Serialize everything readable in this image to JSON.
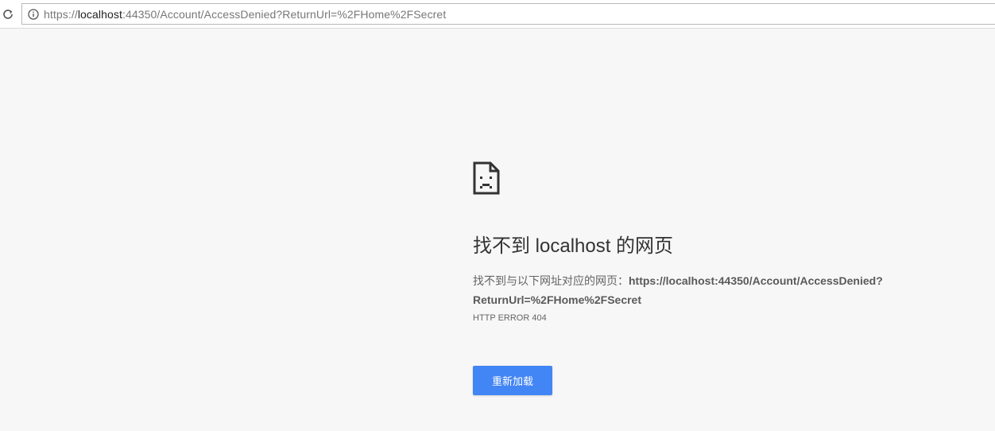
{
  "browser": {
    "url_scheme": "https://",
    "url_host": "localhost",
    "url_rest": ":44350/Account/AccessDenied?ReturnUrl=%2FHome%2FSecret",
    "reload_icon": "reload-icon",
    "info_icon": "info-icon"
  },
  "error_page": {
    "icon": "sad-page-icon",
    "heading": "找不到 localhost 的网页",
    "description_prefix": "找不到与以下网址对应的网页：",
    "description_url": "https://localhost:44350/Account/AccessDenied?ReturnUrl=%2FHome%2FSecret",
    "error_code": "HTTP ERROR 404",
    "reload_button_label": "重新加载",
    "button_color": "#4285f4"
  }
}
